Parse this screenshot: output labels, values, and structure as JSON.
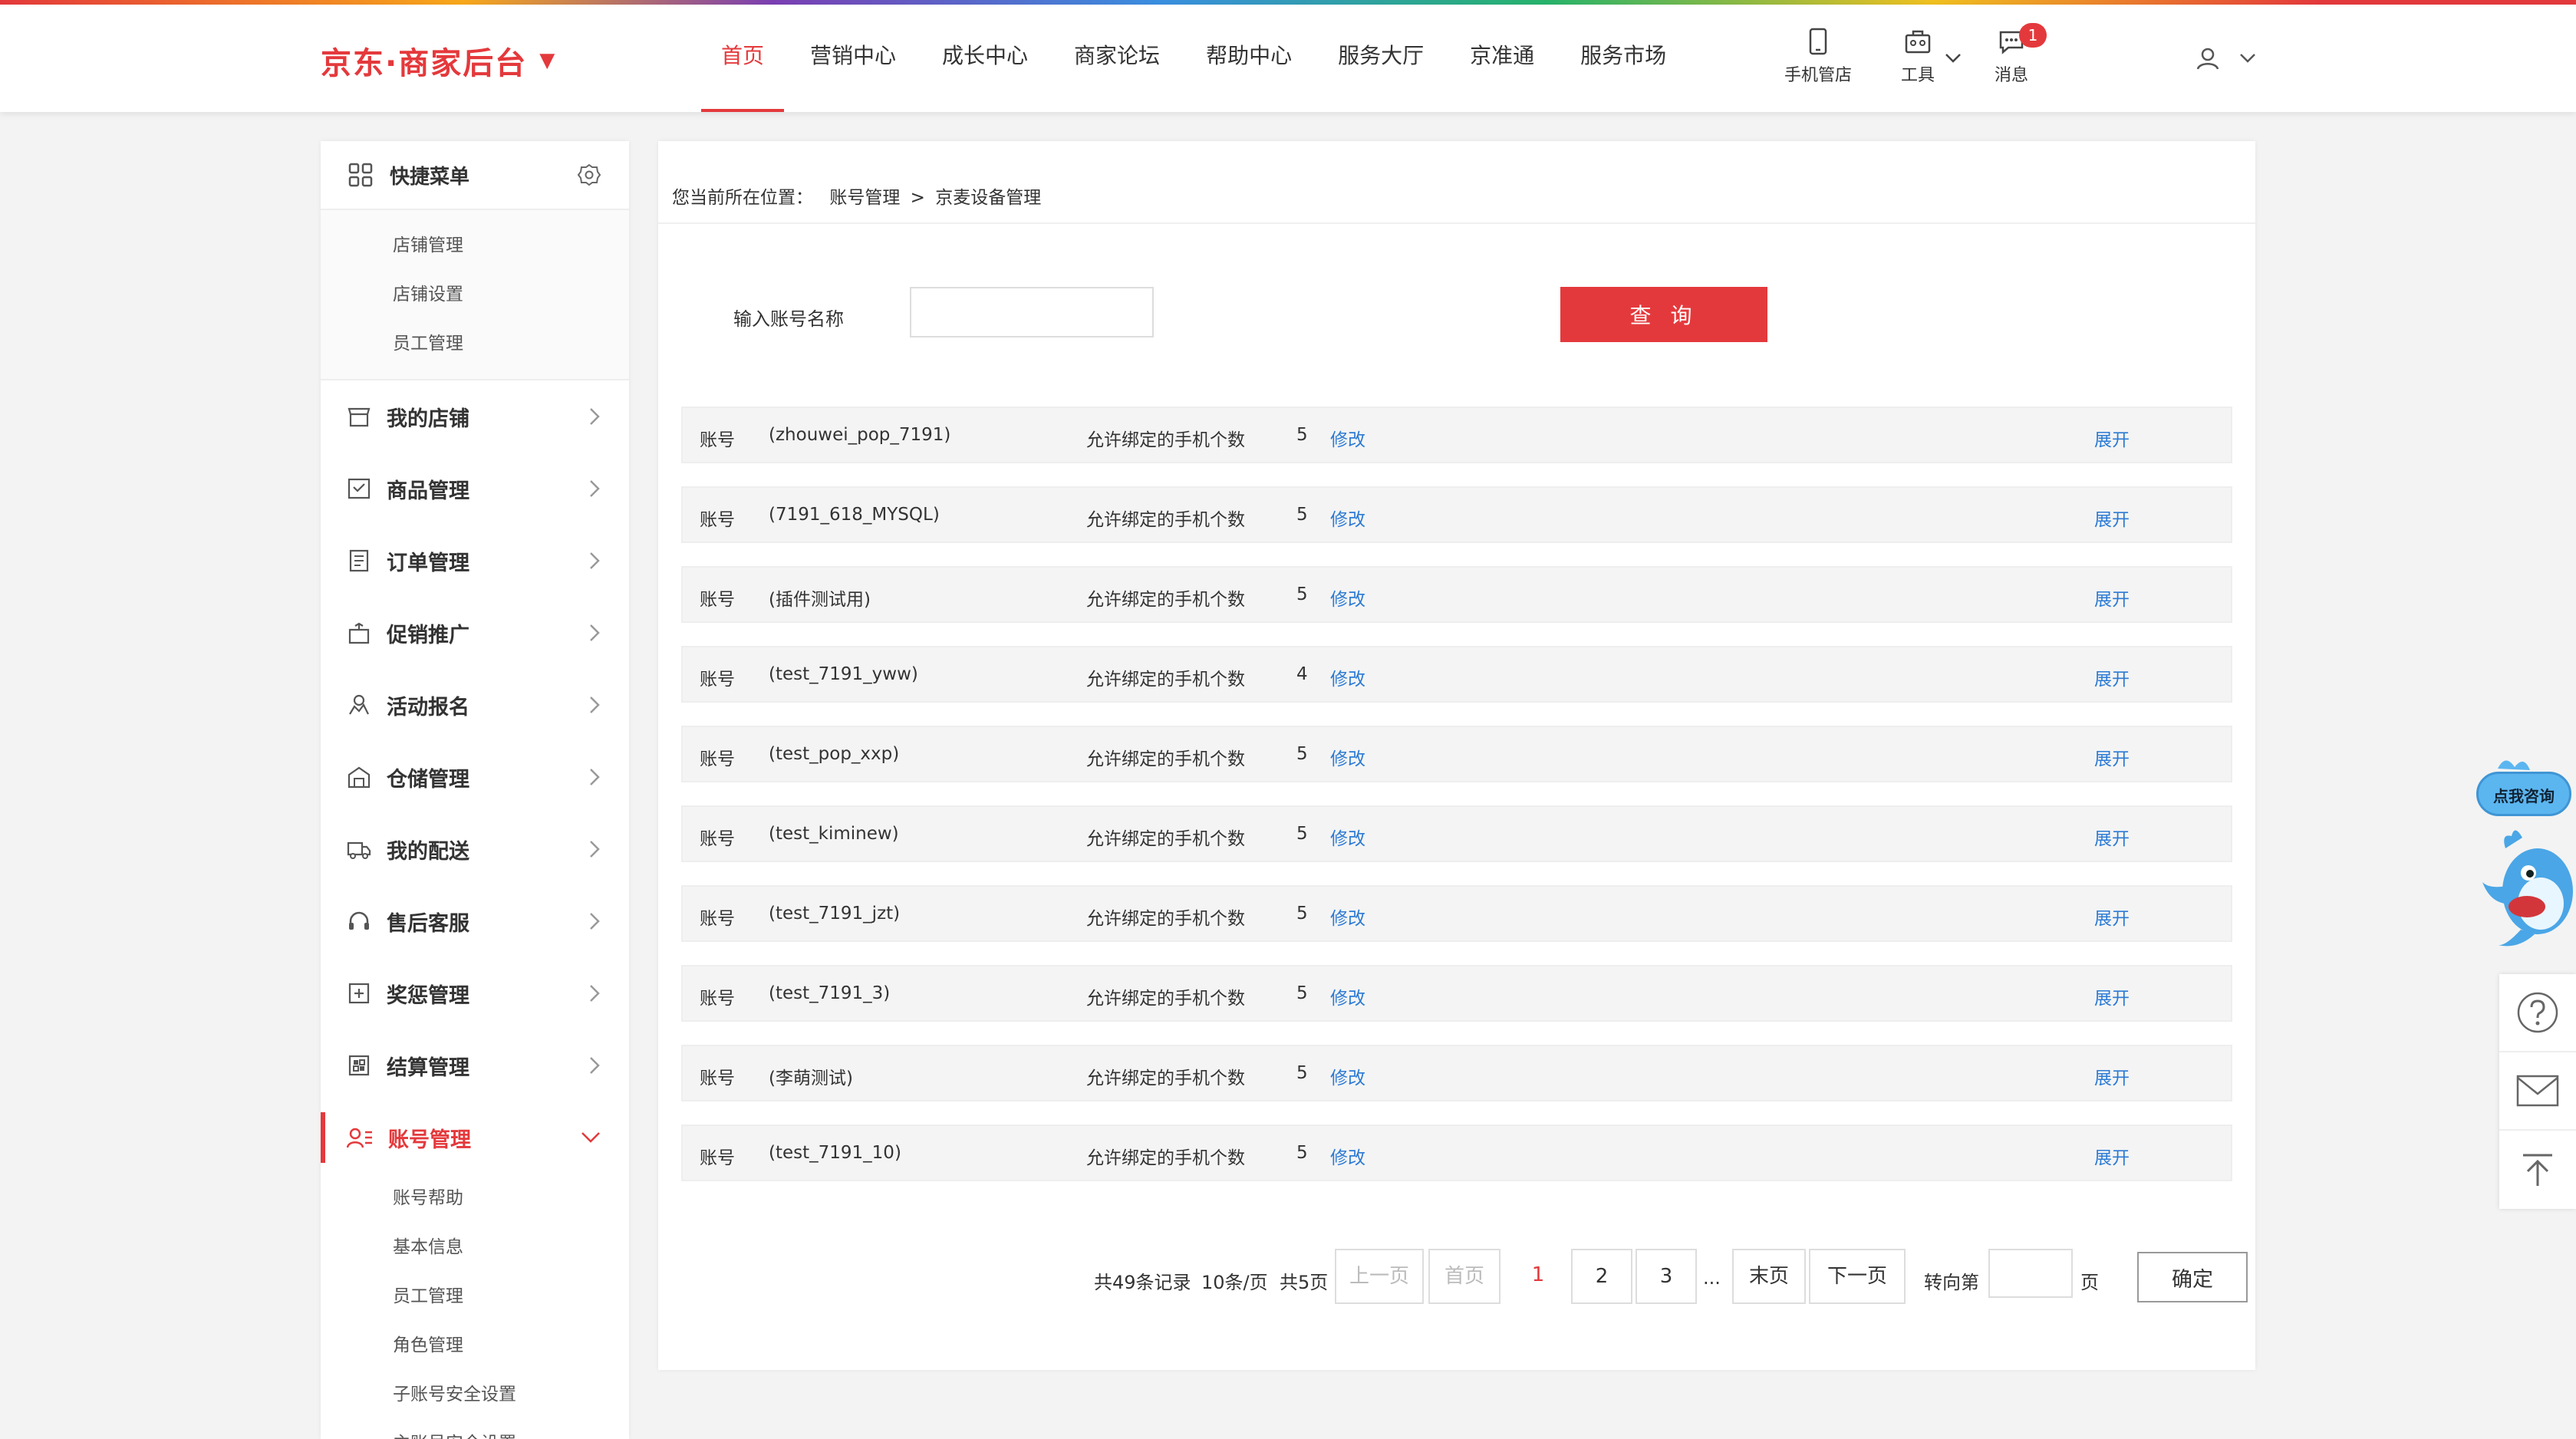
{
  "header": {
    "logo": "京东·商家后台",
    "nav": [
      "首页",
      "营销中心",
      "成长中心",
      "商家论坛",
      "帮助中心",
      "服务大厅",
      "京准通",
      "服务市场"
    ],
    "tools": {
      "mobile_shop": "手机管店",
      "tools": "工具",
      "messages": "消息",
      "message_count": "1"
    }
  },
  "sidebar": {
    "quick_menu_title": "快捷菜单",
    "quick_items": [
      "店铺管理",
      "店铺设置",
      "员工管理"
    ],
    "menu": [
      {
        "label": "我的店铺",
        "icon": "store-icon"
      },
      {
        "label": "商品管理",
        "icon": "goods-icon"
      },
      {
        "label": "订单管理",
        "icon": "order-icon"
      },
      {
        "label": "促销推广",
        "icon": "promotion-icon"
      },
      {
        "label": "活动报名",
        "icon": "activity-icon"
      },
      {
        "label": "仓储管理",
        "icon": "warehouse-icon"
      },
      {
        "label": "我的配送",
        "icon": "delivery-icon"
      },
      {
        "label": "售后客服",
        "icon": "service-icon"
      },
      {
        "label": "奖惩管理",
        "icon": "reward-icon"
      },
      {
        "label": "结算管理",
        "icon": "settlement-icon"
      },
      {
        "label": "账号管理",
        "icon": "account-icon",
        "active": true
      }
    ],
    "account_sub_items": [
      "账号帮助",
      "基本信息",
      "员工管理",
      "角色管理",
      "子账号安全设置",
      "主账号安全设置"
    ]
  },
  "main": {
    "breadcrumb": {
      "prefix": "您当前所在位置：",
      "level1": "账号管理",
      "sep": ">",
      "level2": "京麦设备管理"
    },
    "search": {
      "label": "输入账号名称",
      "value": "",
      "button": "查 询"
    },
    "row_labels": {
      "account": "账号",
      "allowed": "允许绑定的手机个数",
      "edit": "修改",
      "expand": "展开"
    },
    "rows": [
      {
        "account": "(zhouwei_pop_7191)",
        "count": "5"
      },
      {
        "account": "(7191_618_MYSQL)",
        "count": "5"
      },
      {
        "account": "(插件测试用)",
        "count": "5"
      },
      {
        "account": "(test_7191_yww)",
        "count": "4"
      },
      {
        "account": "(test_pop_xxp)",
        "count": "5"
      },
      {
        "account": "(test_kiminew)",
        "count": "5"
      },
      {
        "account": "(test_7191_jzt)",
        "count": "5"
      },
      {
        "account": "(test_7191_3)",
        "count": "5"
      },
      {
        "account": "(李萌测试)",
        "count": "5"
      },
      {
        "account": "(test_7191_10)",
        "count": "5"
      }
    ],
    "pagination": {
      "total": "共49条记录",
      "per_page": "10条/页",
      "pages": "共5页",
      "prev": "上一页",
      "first": "首页",
      "current": "1",
      "page2": "2",
      "page3": "3",
      "ellipsis": "...",
      "last": "末页",
      "next": "下一页",
      "goto": "转向第",
      "page_unit": "页",
      "confirm": "确定"
    }
  },
  "float": {
    "consult": "点我咨询"
  },
  "colors": {
    "brand": "#e4393c",
    "link": "#2d7bd4"
  }
}
